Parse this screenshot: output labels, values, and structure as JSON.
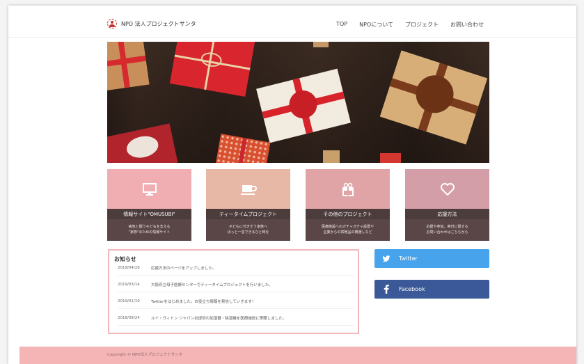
{
  "header": {
    "logo_text": "NPO 法人プロジェクトサンタ",
    "nav": [
      "TOP",
      "NPOについて",
      "プロジェクト",
      "お問い合わせ"
    ]
  },
  "cards": [
    {
      "icon": "monitor-icon",
      "color": "#f0aeb2",
      "title": "情報サイト\"OMUSUBI\"",
      "desc": [
        "病気と闘う子どもを支える",
        "\"家族\"のための情報サイト"
      ]
    },
    {
      "icon": "coffee-cup-icon",
      "color": "#e8b8a6",
      "title": "ティータイムプロジェクト",
      "desc": [
        "子どもに付きそう家族へ",
        "ほっと一息できるひと時を"
      ]
    },
    {
      "icon": "gift-icon",
      "color": "#e1a4a6",
      "title": "その他のプロジェクト",
      "desc": [
        "医療施設へのガチャガチャ設置や",
        "企業からの寄贈品の橋渡しなど"
      ]
    },
    {
      "icon": "heart-icon",
      "color": "#d49ea8",
      "title": "応援方法",
      "desc": [
        "応援や参加、寄付に関する",
        "お問い合わせはこちらから"
      ]
    }
  ],
  "news": {
    "title": "お知らせ",
    "items": [
      {
        "date": "2019/04/28",
        "text": "応援方法のページをアップしました。"
      },
      {
        "date": "2019/03/14",
        "text": "大阪府立母子医療センターでティータイムプロジェクトを行いました。"
      },
      {
        "date": "2019/01/19",
        "text": "Twitterをはじめました。お役立ち情報を発信していきます！"
      },
      {
        "date": "2018/09/24",
        "text": "ルイ・ヴィトン ジャパン社提供の加湿器・除湿機を医療施設に寄贈しました。"
      }
    ]
  },
  "social": {
    "twitter": {
      "label": "Twitter",
      "color": "#47a3ec",
      "icon": "twitter-icon"
    },
    "facebook": {
      "label": "Facebook",
      "color": "#3b5998",
      "icon": "facebook-icon"
    }
  },
  "footer": {
    "text": "Copyright © NPO法人プロジェクトサンタ"
  }
}
